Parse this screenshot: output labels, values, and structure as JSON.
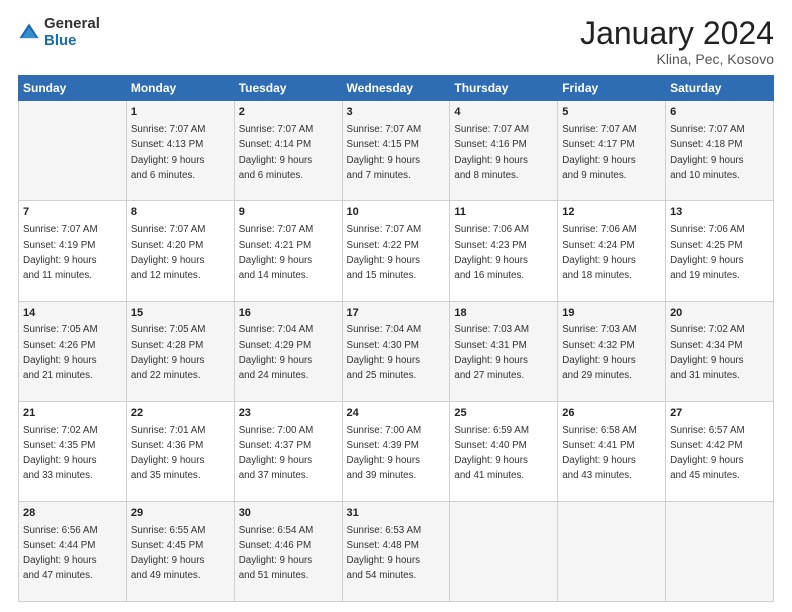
{
  "logo": {
    "general": "General",
    "blue": "Blue"
  },
  "title": "January 2024",
  "subtitle": "Klina, Pec, Kosovo",
  "days_header": [
    "Sunday",
    "Monday",
    "Tuesday",
    "Wednesday",
    "Thursday",
    "Friday",
    "Saturday"
  ],
  "weeks": [
    [
      {
        "day": "",
        "info": ""
      },
      {
        "day": "1",
        "info": "Sunrise: 7:07 AM\nSunset: 4:13 PM\nDaylight: 9 hours\nand 6 minutes."
      },
      {
        "day": "2",
        "info": "Sunrise: 7:07 AM\nSunset: 4:14 PM\nDaylight: 9 hours\nand 6 minutes."
      },
      {
        "day": "3",
        "info": "Sunrise: 7:07 AM\nSunset: 4:15 PM\nDaylight: 9 hours\nand 7 minutes."
      },
      {
        "day": "4",
        "info": "Sunrise: 7:07 AM\nSunset: 4:16 PM\nDaylight: 9 hours\nand 8 minutes."
      },
      {
        "day": "5",
        "info": "Sunrise: 7:07 AM\nSunset: 4:17 PM\nDaylight: 9 hours\nand 9 minutes."
      },
      {
        "day": "6",
        "info": "Sunrise: 7:07 AM\nSunset: 4:18 PM\nDaylight: 9 hours\nand 10 minutes."
      }
    ],
    [
      {
        "day": "7",
        "info": "Sunrise: 7:07 AM\nSunset: 4:19 PM\nDaylight: 9 hours\nand 11 minutes."
      },
      {
        "day": "8",
        "info": "Sunrise: 7:07 AM\nSunset: 4:20 PM\nDaylight: 9 hours\nand 12 minutes."
      },
      {
        "day": "9",
        "info": "Sunrise: 7:07 AM\nSunset: 4:21 PM\nDaylight: 9 hours\nand 14 minutes."
      },
      {
        "day": "10",
        "info": "Sunrise: 7:07 AM\nSunset: 4:22 PM\nDaylight: 9 hours\nand 15 minutes."
      },
      {
        "day": "11",
        "info": "Sunrise: 7:06 AM\nSunset: 4:23 PM\nDaylight: 9 hours\nand 16 minutes."
      },
      {
        "day": "12",
        "info": "Sunrise: 7:06 AM\nSunset: 4:24 PM\nDaylight: 9 hours\nand 18 minutes."
      },
      {
        "day": "13",
        "info": "Sunrise: 7:06 AM\nSunset: 4:25 PM\nDaylight: 9 hours\nand 19 minutes."
      }
    ],
    [
      {
        "day": "14",
        "info": "Sunrise: 7:05 AM\nSunset: 4:26 PM\nDaylight: 9 hours\nand 21 minutes."
      },
      {
        "day": "15",
        "info": "Sunrise: 7:05 AM\nSunset: 4:28 PM\nDaylight: 9 hours\nand 22 minutes."
      },
      {
        "day": "16",
        "info": "Sunrise: 7:04 AM\nSunset: 4:29 PM\nDaylight: 9 hours\nand 24 minutes."
      },
      {
        "day": "17",
        "info": "Sunrise: 7:04 AM\nSunset: 4:30 PM\nDaylight: 9 hours\nand 25 minutes."
      },
      {
        "day": "18",
        "info": "Sunrise: 7:03 AM\nSunset: 4:31 PM\nDaylight: 9 hours\nand 27 minutes."
      },
      {
        "day": "19",
        "info": "Sunrise: 7:03 AM\nSunset: 4:32 PM\nDaylight: 9 hours\nand 29 minutes."
      },
      {
        "day": "20",
        "info": "Sunrise: 7:02 AM\nSunset: 4:34 PM\nDaylight: 9 hours\nand 31 minutes."
      }
    ],
    [
      {
        "day": "21",
        "info": "Sunrise: 7:02 AM\nSunset: 4:35 PM\nDaylight: 9 hours\nand 33 minutes."
      },
      {
        "day": "22",
        "info": "Sunrise: 7:01 AM\nSunset: 4:36 PM\nDaylight: 9 hours\nand 35 minutes."
      },
      {
        "day": "23",
        "info": "Sunrise: 7:00 AM\nSunset: 4:37 PM\nDaylight: 9 hours\nand 37 minutes."
      },
      {
        "day": "24",
        "info": "Sunrise: 7:00 AM\nSunset: 4:39 PM\nDaylight: 9 hours\nand 39 minutes."
      },
      {
        "day": "25",
        "info": "Sunrise: 6:59 AM\nSunset: 4:40 PM\nDaylight: 9 hours\nand 41 minutes."
      },
      {
        "day": "26",
        "info": "Sunrise: 6:58 AM\nSunset: 4:41 PM\nDaylight: 9 hours\nand 43 minutes."
      },
      {
        "day": "27",
        "info": "Sunrise: 6:57 AM\nSunset: 4:42 PM\nDaylight: 9 hours\nand 45 minutes."
      }
    ],
    [
      {
        "day": "28",
        "info": "Sunrise: 6:56 AM\nSunset: 4:44 PM\nDaylight: 9 hours\nand 47 minutes."
      },
      {
        "day": "29",
        "info": "Sunrise: 6:55 AM\nSunset: 4:45 PM\nDaylight: 9 hours\nand 49 minutes."
      },
      {
        "day": "30",
        "info": "Sunrise: 6:54 AM\nSunset: 4:46 PM\nDaylight: 9 hours\nand 51 minutes."
      },
      {
        "day": "31",
        "info": "Sunrise: 6:53 AM\nSunset: 4:48 PM\nDaylight: 9 hours\nand 54 minutes."
      },
      {
        "day": "",
        "info": ""
      },
      {
        "day": "",
        "info": ""
      },
      {
        "day": "",
        "info": ""
      }
    ]
  ]
}
